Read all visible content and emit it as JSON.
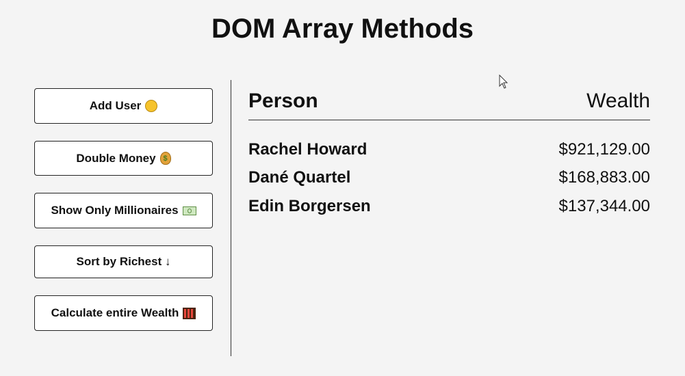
{
  "header": {
    "title": "DOM Array Methods"
  },
  "sidebar": {
    "buttons": [
      {
        "label": "Add User",
        "icon": "man-face-emoji-icon"
      },
      {
        "label": "Double Money",
        "icon": "money-bag-emoji-icon"
      },
      {
        "label": "Show Only Millionaires",
        "icon": "dollar-banknote-emoji-icon"
      },
      {
        "label": "Sort by Richest ↓",
        "icon": ""
      },
      {
        "label": "Calculate entire Wealth",
        "icon": "abacus-emoji-icon"
      }
    ]
  },
  "main": {
    "columns": {
      "person": "Person",
      "wealth": "Wealth"
    },
    "people": [
      {
        "name": "Rachel Howard",
        "money": "$921,129.00"
      },
      {
        "name": "Dané Quartel",
        "money": "$168,883.00"
      },
      {
        "name": "Edin Borgersen",
        "money": "$137,344.00"
      }
    ]
  },
  "colors": {
    "background": "#f4f4f4",
    "button_background": "#ffffff",
    "text": "#111111",
    "border": "#222222"
  }
}
